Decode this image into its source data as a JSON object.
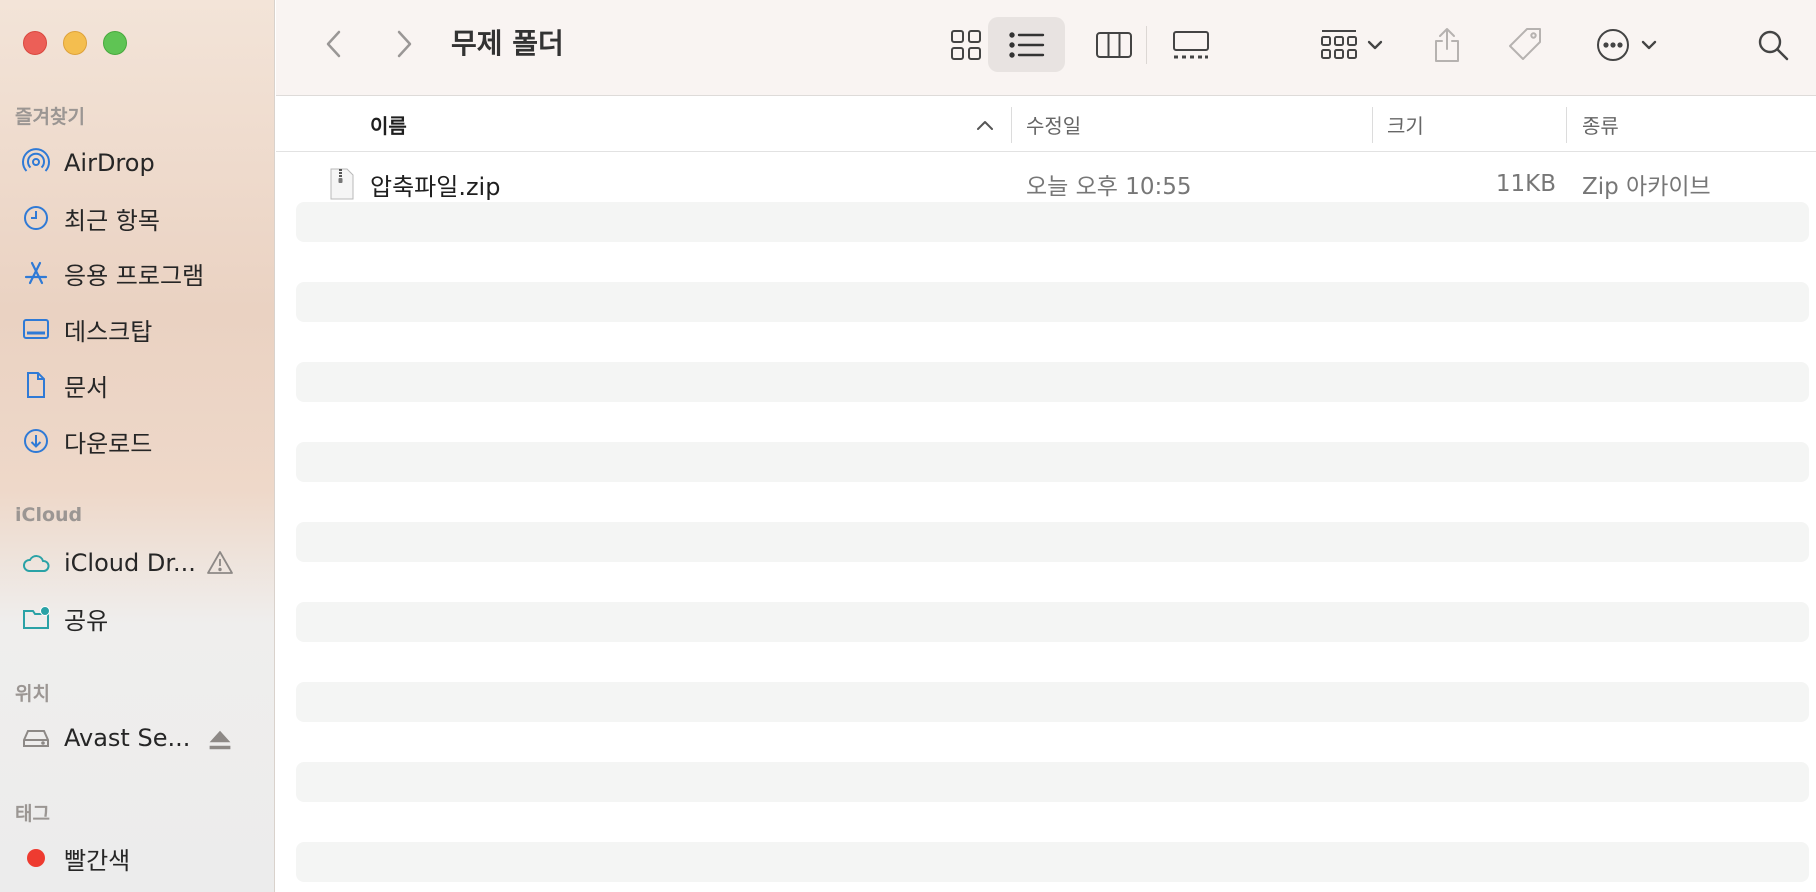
{
  "window": {
    "title": "무제 폴더"
  },
  "sidebar": {
    "favorites_title": "즐겨찾기",
    "favorites": [
      {
        "label": "AirDrop",
        "icon": "airdrop-icon"
      },
      {
        "label": "최근 항목",
        "icon": "clock-icon"
      },
      {
        "label": "응용 프로그램",
        "icon": "applications-icon"
      },
      {
        "label": "데스크탑",
        "icon": "desktop-icon"
      },
      {
        "label": "문서",
        "icon": "document-icon"
      },
      {
        "label": "다운로드",
        "icon": "download-icon"
      }
    ],
    "icloud_title": "iCloud",
    "icloud": [
      {
        "label": "iCloud Dr...",
        "icon": "cloud-icon",
        "badge_icon": "warning-icon"
      },
      {
        "label": "공유",
        "icon": "shared-folder-icon"
      }
    ],
    "locations_title": "위치",
    "locations": [
      {
        "label": "Avast Se...",
        "icon": "disk-icon",
        "badge_icon": "eject-icon"
      }
    ],
    "tags_title": "태그",
    "tags": [
      {
        "label": "빨간색",
        "color": "#ee3b30"
      }
    ]
  },
  "toolbar": {
    "back_icon": "chevron-left-icon",
    "forward_icon": "chevron-right-icon",
    "views": [
      "icon-view",
      "list-view",
      "column-view",
      "gallery-view"
    ],
    "active_view": "list-view"
  },
  "columns": {
    "name": "이름",
    "modified": "수정일",
    "size": "크기",
    "kind": "종류"
  },
  "files": [
    {
      "name": "압축파일.zip",
      "modified": "오늘 오후 10:55",
      "size": "11KB",
      "kind": "Zip 아카이브",
      "icon": "zip-file-icon"
    }
  ],
  "colors": {
    "accent": "#1a73e8",
    "sidebar_icon": "#2f7ad6",
    "icloud_icon": "#2aa2a6"
  }
}
